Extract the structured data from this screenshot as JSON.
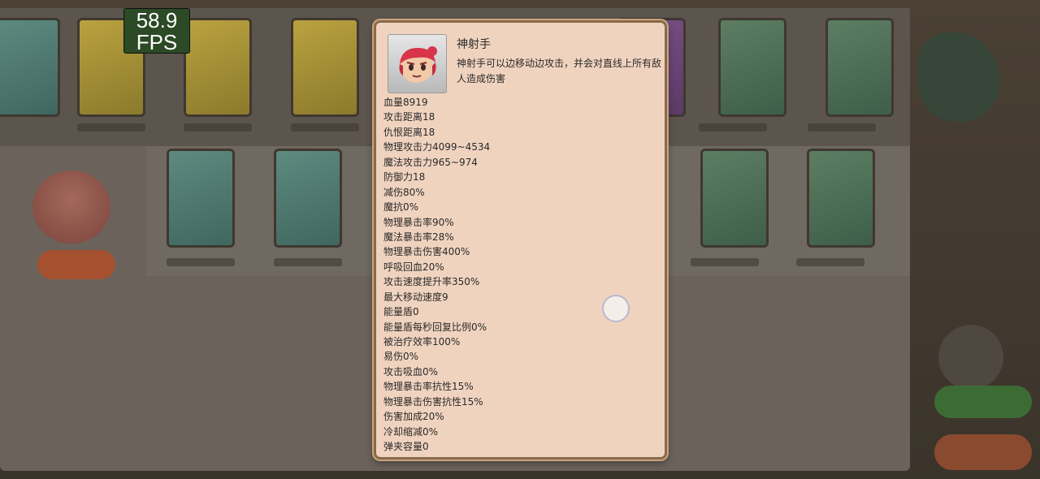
{
  "fps": {
    "value": "58.9",
    "unit": "FPS"
  },
  "hero": {
    "name": "神射手",
    "description": "神射手可以边移动边攻击，并会对直线上所有敌人造成伤害",
    "avatar_icon": "archer-portrait-icon"
  },
  "stats": [
    "血量8919",
    "攻击距离18",
    "仇恨距离18",
    "物理攻击力4099~4534",
    "魔法攻击力965~974",
    "防御力18",
    "减伤80%",
    "魔抗0%",
    "物理暴击率90%",
    "魔法暴击率28%",
    "物理暴击伤害400%",
    "呼吸回血20%",
    "攻击速度提升率350%",
    "最大移动速度9",
    "能量盾0",
    "能量盾每秒回复比例0%",
    "被治疗效率100%",
    "易伤0%",
    "攻击吸血0%",
    "物理暴击率抗性15%",
    "物理暴击伤害抗性15%",
    "伤害加成20%",
    "冷却缩减0%",
    "弹夹容量0"
  ],
  "colors": {
    "popup_bg": "#f0d3bf",
    "popup_border": "#8a6a4a",
    "fps_bg": "#2b4a25"
  }
}
